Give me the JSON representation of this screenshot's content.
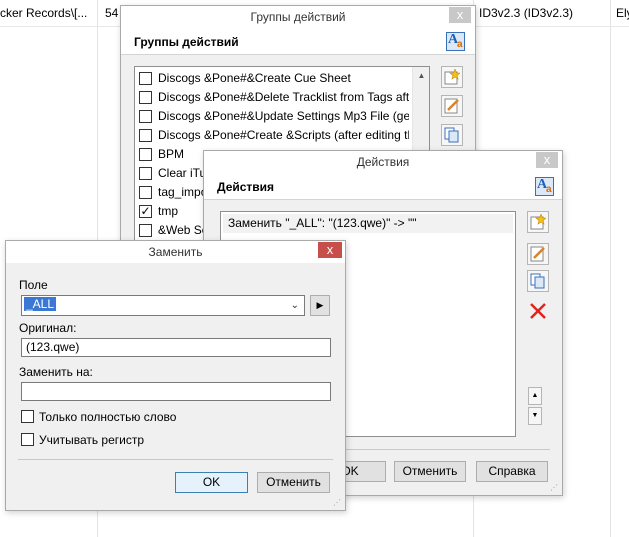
{
  "background": {
    "col1": "cker Records\\[...",
    "col2": "54",
    "col3": "ID3v2.3 (ID3v2.3)",
    "col4": "Ely"
  },
  "groups_window": {
    "title": "Группы действий",
    "header": "Группы действий",
    "close": "x",
    "items": [
      {
        "label": "Discogs &Pone#&Create Cue Sheet",
        "checked": false
      },
      {
        "label": "Discogs &Pone#&Delete Tracklist from Tags aft",
        "checked": false
      },
      {
        "label": "Discogs &Pone#&Update Settings Mp3 File (get",
        "checked": false
      },
      {
        "label": "Discogs &Pone#Create &Scripts (after editing th",
        "checked": false
      },
      {
        "label": "BPM",
        "checked": false
      },
      {
        "label": "Clear iTu",
        "checked": false
      },
      {
        "label": "tag_impo",
        "checked": false
      },
      {
        "label": "tmp",
        "checked": true
      },
      {
        "label": "&Web Sc",
        "checked": false
      }
    ]
  },
  "actions_window": {
    "title": "Действия",
    "header": "Действия",
    "close": "x",
    "action_entry": "Заменить \"_ALL\": \"(123.qwe)\" -> \"\"",
    "ok_partial": "OK",
    "cancel": "Отменить",
    "help": "Справка"
  },
  "replace_dialog": {
    "title": "Заменить",
    "close": "x",
    "field_label": "Поле",
    "field_value": "_ALL",
    "original_label": "Оригинал:",
    "original_value": "(123.qwe)",
    "replace_label": "Заменить на:",
    "replace_value": "",
    "whole_word": "Только полностью слово",
    "case_sensitive": "Учитывать регистр",
    "ok": "OK",
    "cancel": "Отменить"
  }
}
